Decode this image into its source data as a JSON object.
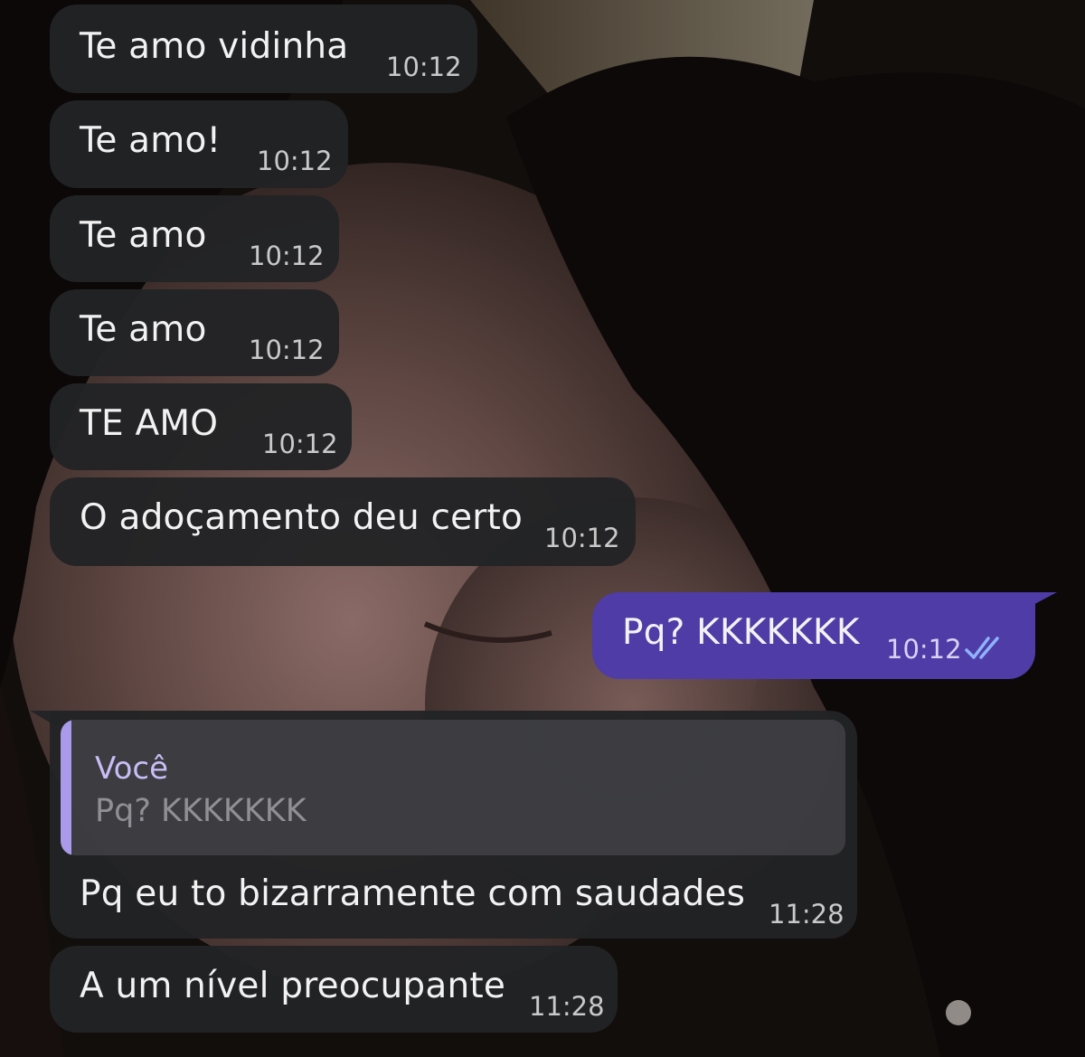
{
  "colors": {
    "incoming_bubble": "#222325",
    "outgoing_bubble": "#4f3ca6",
    "quote_accent": "#a99bea",
    "read_ticks": "#8fb3ff"
  },
  "messages": [
    {
      "direction": "in",
      "text": "Te amo vidinha",
      "time": "10:12"
    },
    {
      "direction": "in",
      "text": "Te amo!",
      "time": "10:12"
    },
    {
      "direction": "in",
      "text": "Te amo",
      "time": "10:12"
    },
    {
      "direction": "in",
      "text": "Te amo",
      "time": "10:12"
    },
    {
      "direction": "in",
      "text": "TE AMO",
      "time": "10:12"
    },
    {
      "direction": "in",
      "text": "O adoçamento deu certo",
      "time": "10:12"
    },
    {
      "direction": "out",
      "text": "Pq? KKKKKKK",
      "time": "10:12",
      "status_icon": "double-check-read-icon"
    },
    {
      "direction": "in",
      "reply_to": {
        "author": "Você",
        "text": "Pq? KKKKKKK"
      },
      "text": "Pq eu to bizarramente com saudades",
      "time": "11:28"
    },
    {
      "direction": "in",
      "text": "A um nível preocupante",
      "time": "11:28"
    }
  ]
}
